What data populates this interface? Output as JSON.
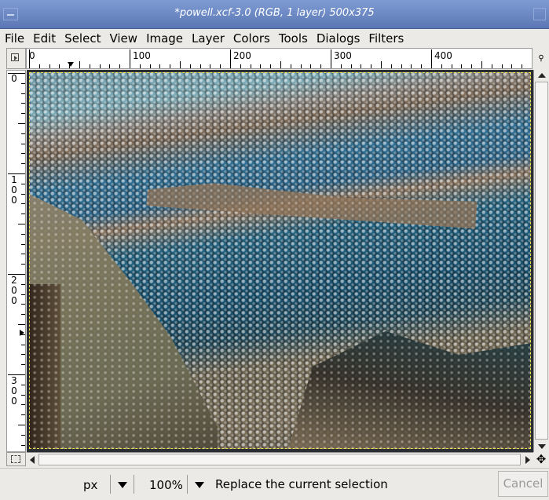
{
  "window": {
    "title": "*powell.xcf-3.0 (RGB, 1 layer) 500x375"
  },
  "menu": {
    "items": [
      "File",
      "Edit",
      "Select",
      "View",
      "Image",
      "Layer",
      "Colors",
      "Tools",
      "Dialogs",
      "Filters"
    ]
  },
  "rulers": {
    "horizontal_labels": [
      "0",
      "100",
      "200",
      "300",
      "400"
    ],
    "vertical_labels": [
      "0",
      "100",
      "200",
      "300"
    ]
  },
  "status": {
    "unit": "px",
    "zoom": "100%",
    "message": "Replace the current selection",
    "cancel_label": "Cancel"
  },
  "icons": {
    "menu_button": "triangle-menu-icon",
    "quick_mask": "quick-mask-icon",
    "navigate": "navigate-icon",
    "zoom": "zoom-icon"
  }
}
